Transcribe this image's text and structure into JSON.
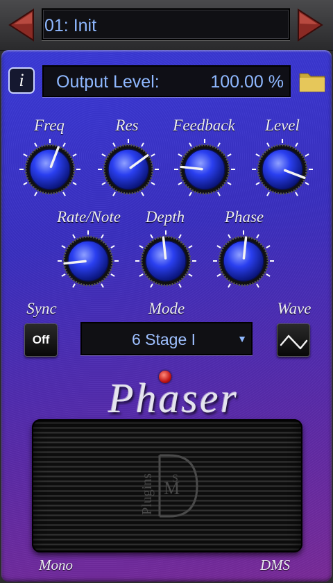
{
  "header": {
    "preset_name": "01: Init",
    "prev_icon": "left-triangle-icon",
    "next_icon": "right-triangle-icon"
  },
  "parameter_display": {
    "info_label": "i",
    "label": "Output Level:",
    "value": "100.00 %",
    "folder_icon": "folder-icon"
  },
  "knobs_row1": [
    {
      "label": "Freq",
      "level": 0.57
    },
    {
      "label": "Res",
      "level": 0.68
    },
    {
      "label": "Feedback",
      "level": 0.22
    },
    {
      "label": "Level",
      "level": 0.87
    }
  ],
  "knobs_row2": [
    {
      "label": "Rate/Note",
      "level": 0.18
    },
    {
      "label": "Depth",
      "level": 0.48
    },
    {
      "label": "Phase",
      "level": 0.52
    }
  ],
  "controls": {
    "sync_label": "Sync",
    "sync_value": "Off",
    "mode_label": "Mode",
    "mode_value": "6 Stage I",
    "wave_label": "Wave",
    "wave_icon": "triangle-wave-icon"
  },
  "brand": "Phaser",
  "logo_text": {
    "plugins": "Plugins",
    "letters": "DMS"
  },
  "footer": {
    "left": "Mono",
    "right": "DMS"
  },
  "colors": {
    "body_top": "#3a3ad8",
    "body_bottom": "#7a2a98",
    "display_text": "#8fb8ff",
    "knob_blue": "#2a3ff0",
    "led": "#c01414"
  }
}
